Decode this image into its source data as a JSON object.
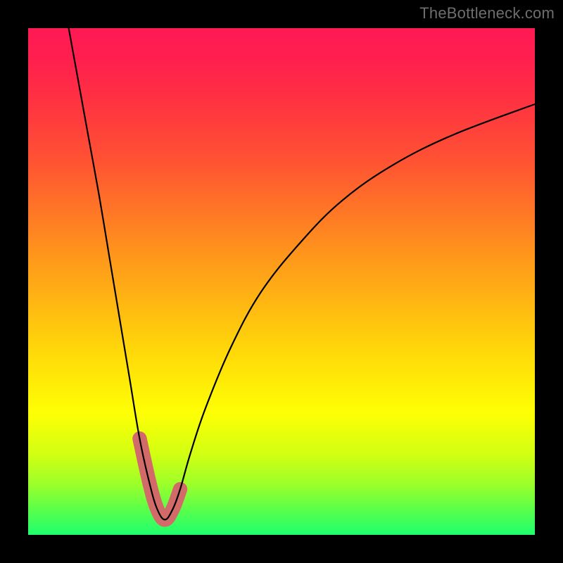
{
  "watermark": "TheBottleneck.com",
  "chart_data": {
    "type": "line",
    "title": "",
    "xlabel": "",
    "ylabel": "",
    "xlim": [
      0,
      100
    ],
    "ylim": [
      0,
      100
    ],
    "grid": false,
    "legend": false,
    "highlight": {
      "range_x": [
        22,
        31
      ],
      "color": "#d36a6a",
      "stroke_width": 12
    },
    "series": [
      {
        "name": "curve",
        "color": "#000000",
        "stroke_width": 2,
        "x": [
          8,
          10,
          12,
          14,
          16,
          18,
          20,
          22,
          24,
          25.5,
          27,
          28.5,
          30,
          32,
          35,
          40,
          46,
          54,
          62,
          72,
          84,
          100
        ],
        "y": [
          100,
          89,
          78,
          67,
          55,
          43,
          31,
          19,
          10,
          5,
          3,
          5,
          9,
          16,
          25,
          37,
          48,
          58,
          66,
          73,
          79,
          85
        ]
      }
    ]
  }
}
